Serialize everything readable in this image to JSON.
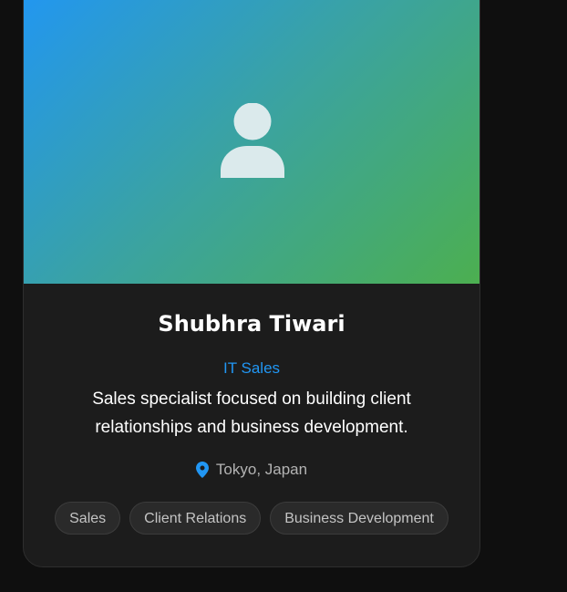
{
  "profile": {
    "name": "Shubhra Tiwari",
    "title": "IT Sales",
    "description": "Sales specialist focused on building client relationships and business development.",
    "location": "Tokyo, Japan",
    "tags": [
      "Sales",
      "Client Relations",
      "Business Development"
    ]
  },
  "icons": {
    "avatar": "user-placeholder-icon",
    "location": "map-pin-icon"
  },
  "colors": {
    "accent": "#2196f3",
    "gradient_start": "#2196f3",
    "gradient_end": "#4caf50",
    "card_background": "#1c1c1c",
    "page_background": "#0f0f0f"
  }
}
